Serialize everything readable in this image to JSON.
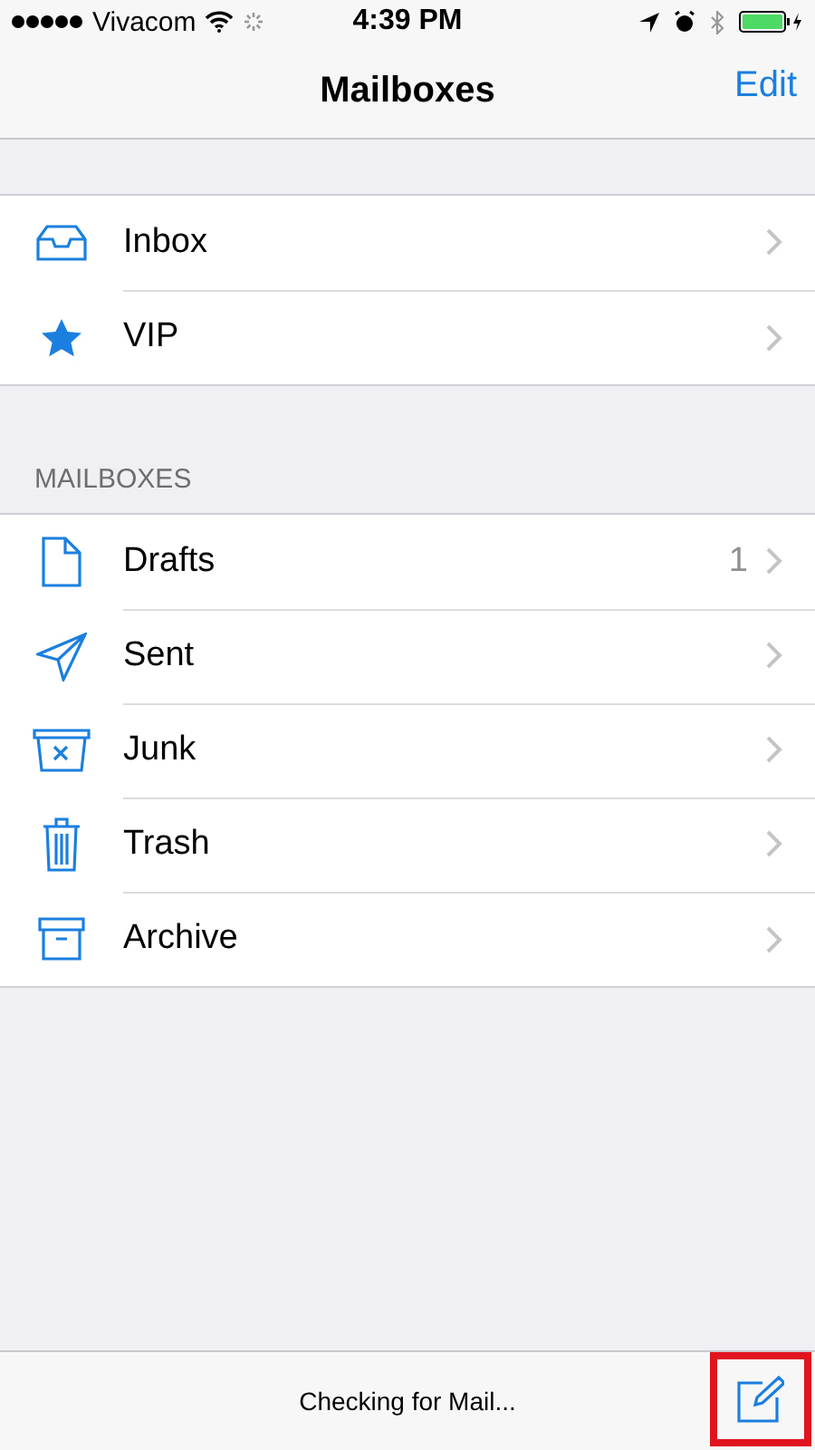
{
  "status_bar": {
    "carrier": "Vivacom",
    "time": "4:39 PM"
  },
  "nav": {
    "title": "Mailboxes",
    "edit": "Edit"
  },
  "favorites": [
    {
      "kind": "inbox",
      "label": "Inbox"
    },
    {
      "kind": "star",
      "label": "VIP"
    }
  ],
  "section_title": "MAILBOXES",
  "mailboxes": [
    {
      "kind": "drafts",
      "label": "Drafts",
      "count": "1"
    },
    {
      "kind": "sent",
      "label": "Sent"
    },
    {
      "kind": "junk",
      "label": "Junk"
    },
    {
      "kind": "trash",
      "label": "Trash"
    },
    {
      "kind": "archive",
      "label": "Archive"
    }
  ],
  "toolbar": {
    "status": "Checking for Mail...",
    "compose_highlighted": true
  }
}
